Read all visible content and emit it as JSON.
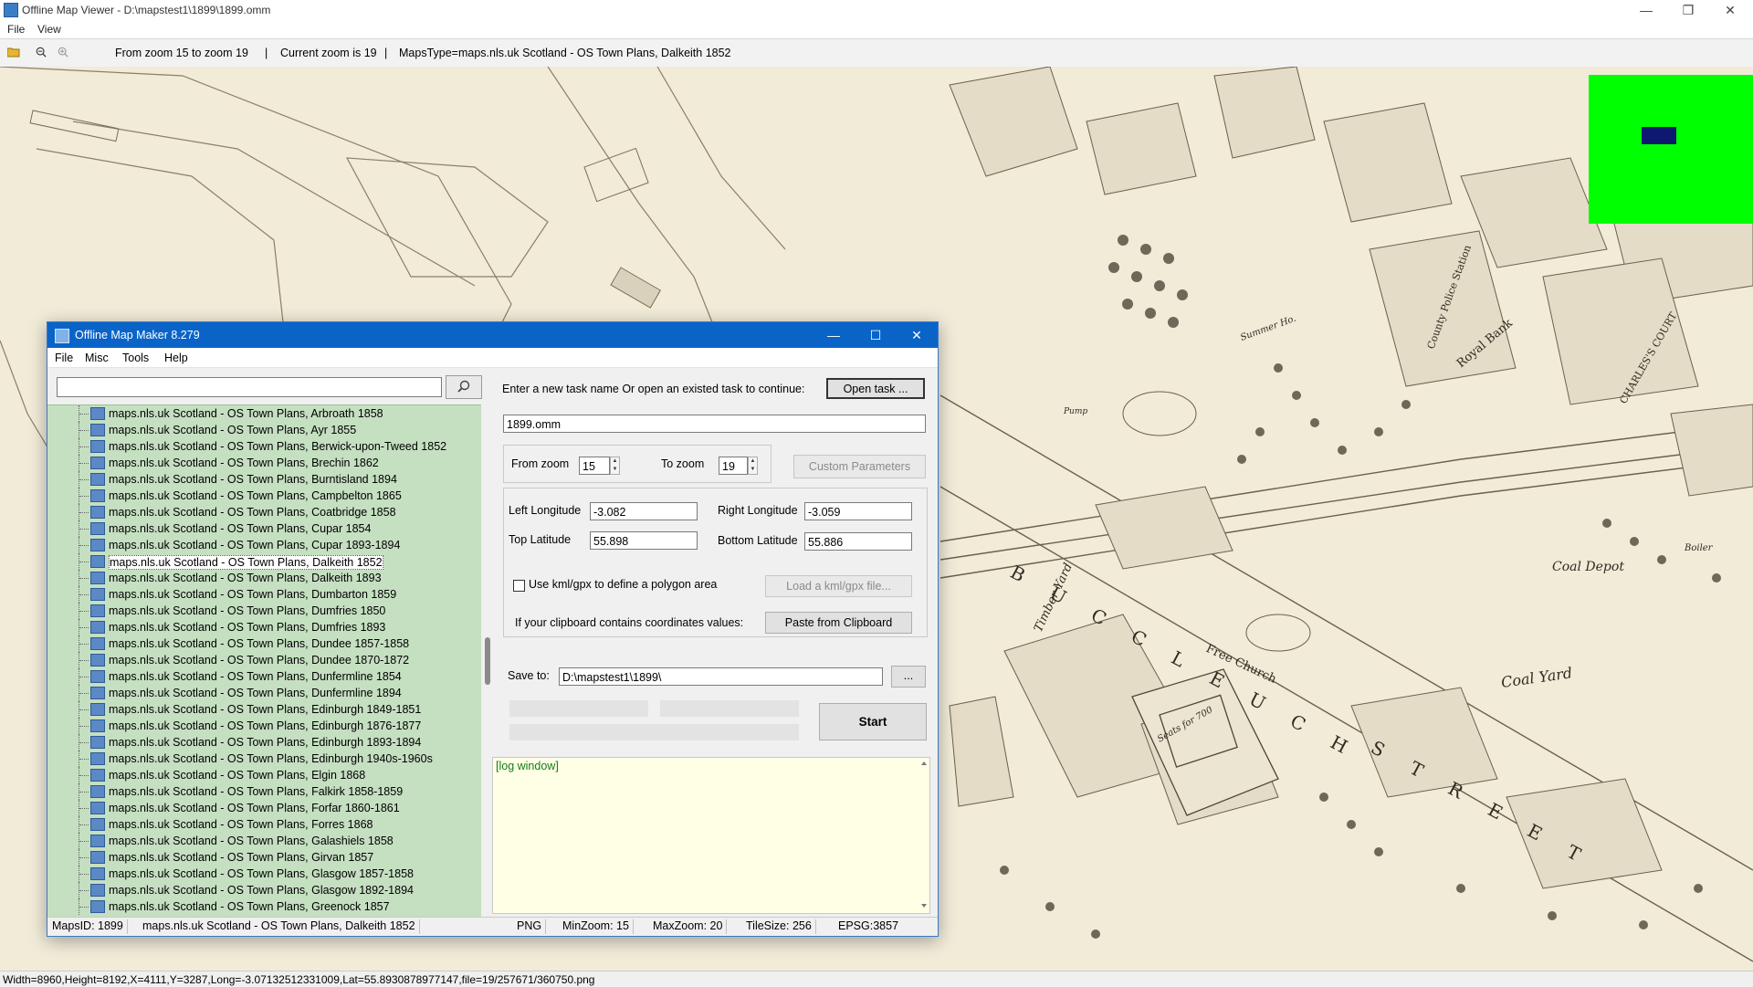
{
  "viewer": {
    "title": "Offline Map Viewer - D:\\mapstest1\\1899\\1899.omm",
    "menu": [
      "File",
      "View"
    ],
    "toolbar": {
      "zoom_range": "From zoom 15 to zoom 19",
      "separator": "|",
      "current_zoom": "Current zoom is 19",
      "maps_type": "MapsType=maps.nls.uk Scotland - OS Town Plans, Dalkeith 1852"
    },
    "status": "Width=8960,Height=8192,X=4111,Y=3287,Long=-3.07132512331009,Lat=55.8930878977147,file=19/257671/360750.png",
    "minimap_color": "#00ff00",
    "minimap_viewport_color": "#0f1870"
  },
  "map": {
    "labels": [
      {
        "text": "B U C C L E U C H",
        "key": "buccleuch"
      },
      {
        "text": "S T R E E T",
        "key": "street"
      },
      {
        "text": "Coal Depot",
        "key": "coal-depot"
      },
      {
        "text": "Coal Yard",
        "key": "coal-yard"
      },
      {
        "text": "Free Church",
        "key": "free-church"
      },
      {
        "text": "Seats for 700",
        "key": "seats"
      },
      {
        "text": "Timber Yard",
        "key": "timber-yard"
      },
      {
        "text": "Royal Bank",
        "key": "royal-bank"
      },
      {
        "text": "County Police Station",
        "key": "police"
      },
      {
        "text": "CHARLES'S COURT",
        "key": "charles-court"
      },
      {
        "text": "Summer Ho.",
        "key": "summer-ho"
      },
      {
        "text": "Pump",
        "key": "pump"
      },
      {
        "text": "Boiler",
        "key": "boiler"
      }
    ]
  },
  "dialog": {
    "title": "Offline Map Maker 8.279",
    "menu": [
      "File",
      "Misc",
      "Tools",
      "Help"
    ],
    "search": {
      "value": ""
    },
    "tree_items": [
      "maps.nls.uk Scotland - OS Town Plans, Arbroath 1858",
      "maps.nls.uk Scotland - OS Town Plans, Ayr 1855",
      "maps.nls.uk Scotland - OS Town Plans, Berwick-upon-Tweed 1852",
      "maps.nls.uk Scotland - OS Town Plans, Brechin 1862",
      "maps.nls.uk Scotland - OS Town Plans, Burntisland 1894",
      "maps.nls.uk Scotland - OS Town Plans, Campbelton 1865",
      "maps.nls.uk Scotland - OS Town Plans, Coatbridge 1858",
      "maps.nls.uk Scotland - OS Town Plans, Cupar 1854",
      "maps.nls.uk Scotland - OS Town Plans, Cupar 1893-1894",
      "maps.nls.uk Scotland - OS Town Plans, Dalkeith 1852",
      "maps.nls.uk Scotland - OS Town Plans, Dalkeith 1893",
      "maps.nls.uk Scotland - OS Town Plans, Dumbarton 1859",
      "maps.nls.uk Scotland - OS Town Plans, Dumfries 1850",
      "maps.nls.uk Scotland - OS Town Plans, Dumfries 1893",
      "maps.nls.uk Scotland - OS Town Plans, Dundee 1857-1858",
      "maps.nls.uk Scotland - OS Town Plans, Dundee 1870-1872",
      "maps.nls.uk Scotland - OS Town Plans, Dunfermline 1854",
      "maps.nls.uk Scotland - OS Town Plans, Dunfermline 1894",
      "maps.nls.uk Scotland - OS Town Plans, Edinburgh 1849-1851",
      "maps.nls.uk Scotland - OS Town Plans, Edinburgh 1876-1877",
      "maps.nls.uk Scotland - OS Town Plans, Edinburgh 1893-1894",
      "maps.nls.uk Scotland - OS Town Plans, Edinburgh 1940s-1960s",
      "maps.nls.uk Scotland - OS Town Plans, Elgin 1868",
      "maps.nls.uk Scotland - OS Town Plans, Falkirk 1858-1859",
      "maps.nls.uk Scotland - OS Town Plans, Forfar 1860-1861",
      "maps.nls.uk Scotland - OS Town Plans, Forres 1868",
      "maps.nls.uk Scotland - OS Town Plans, Galashiels 1858",
      "maps.nls.uk Scotland - OS Town Plans, Girvan 1857",
      "maps.nls.uk Scotland - OS Town Plans, Glasgow 1857-1858",
      "maps.nls.uk Scotland - OS Town Plans, Glasgow 1892-1894",
      "maps.nls.uk Scotland - OS Town Plans, Greenock 1857"
    ],
    "selected_index": 9,
    "task_prompt": "Enter a new task name Or open an existed task to continue:",
    "open_task_label": "Open task ...",
    "task_name": "1899.omm",
    "from_zoom_label": "From zoom",
    "from_zoom": "15",
    "to_zoom_label": "To zoom",
    "to_zoom": "19",
    "custom_params_label": "Custom Parameters",
    "left_long_label": "Left Longitude",
    "left_long": "-3.082",
    "right_long_label": "Right Longitude",
    "right_long": "-3.059",
    "top_lat_label": "Top Latitude",
    "top_lat": "55.898",
    "bottom_lat_label": "Bottom Latitude",
    "bottom_lat": "55.886",
    "kml_label": "Use kml/gpx to define a polygon area",
    "load_kml_label": "Load a kml/gpx file...",
    "clipboard_prompt": "If your clipboard contains coordinates values:",
    "paste_label": "Paste from Clipboard",
    "save_to_label": "Save to:",
    "save_to": "D:\\mapstest1\\1899\\",
    "browse_label": "...",
    "start_label": "Start",
    "log_placeholder": "[log window]",
    "status": {
      "maps_id": "MapsID: 1899",
      "maps_name": "maps.nls.uk Scotland - OS Town Plans, Dalkeith 1852",
      "format": "PNG",
      "min_zoom": "MinZoom: 15",
      "max_zoom": "MaxZoom: 20",
      "tile_size": "TileSize: 256",
      "epsg": "EPSG:3857"
    }
  }
}
